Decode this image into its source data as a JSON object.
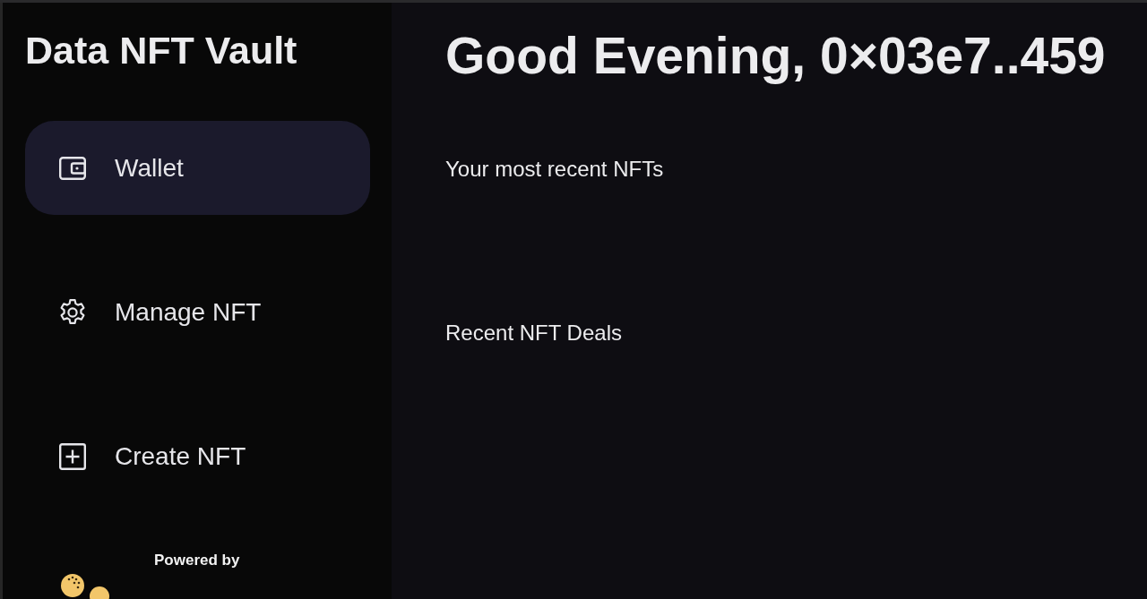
{
  "sidebar": {
    "title": "Data NFT Vault",
    "items": [
      {
        "label": "Wallet",
        "selected": true
      },
      {
        "label": "Manage NFT",
        "selected": false
      },
      {
        "label": "Create NFT",
        "selected": false
      }
    ],
    "footer": {
      "text": "Powered by"
    }
  },
  "main": {
    "greeting": "Good Evening, 0×03e7..459",
    "sections": [
      {
        "title": "Your most recent NFTs"
      },
      {
        "title": "Recent NFT Deals"
      }
    ]
  }
}
